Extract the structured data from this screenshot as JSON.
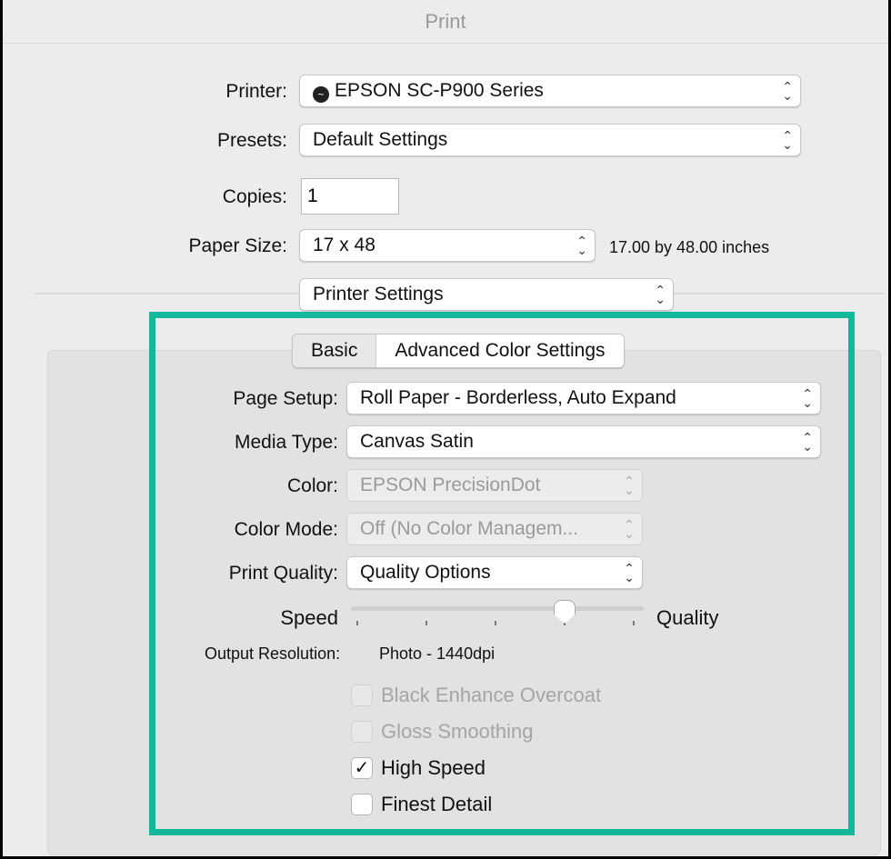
{
  "window": {
    "title": "Print"
  },
  "printer": {
    "label": "Printer:",
    "value": "EPSON SC-P900 Series",
    "icon": "printer-status-icon"
  },
  "presets": {
    "label": "Presets:",
    "value": "Default Settings"
  },
  "copies": {
    "label": "Copies:",
    "value": "1"
  },
  "paper_size": {
    "label": "Paper Size:",
    "value": "17 x 48",
    "description": "17.00 by 48.00 inches"
  },
  "section": {
    "value": "Printer Settings"
  },
  "tabs": [
    {
      "label": "Basic"
    },
    {
      "label": "Advanced Color Settings"
    }
  ],
  "page_setup": {
    "label": "Page Setup:",
    "value": "Roll Paper - Borderless, Auto Expand"
  },
  "media_type": {
    "label": "Media Type:",
    "value": "Canvas Satin"
  },
  "color": {
    "label": "Color:",
    "value": "EPSON PrecisionDot",
    "disabled": true
  },
  "color_mode": {
    "label": "Color Mode:",
    "value": "Off (No Color Managem...",
    "disabled": true
  },
  "print_quality": {
    "label": "Print Quality:",
    "value": "Quality Options"
  },
  "slider": {
    "min_label": "Speed",
    "max_label": "Quality",
    "ticks": 5,
    "position": 3
  },
  "output_resolution": {
    "label": "Output Resolution:",
    "value": "Photo - 1440dpi"
  },
  "checkboxes": [
    {
      "label": "Black Enhance Overcoat",
      "checked": false,
      "disabled": true
    },
    {
      "label": "Gloss Smoothing",
      "checked": false,
      "disabled": true
    },
    {
      "label": "High Speed",
      "checked": true,
      "disabled": false
    },
    {
      "label": "Finest Detail",
      "checked": false,
      "disabled": false
    }
  ],
  "colors": {
    "highlight_frame": "#12b899",
    "background": "#ececec",
    "panel": "#e2e2e2"
  }
}
